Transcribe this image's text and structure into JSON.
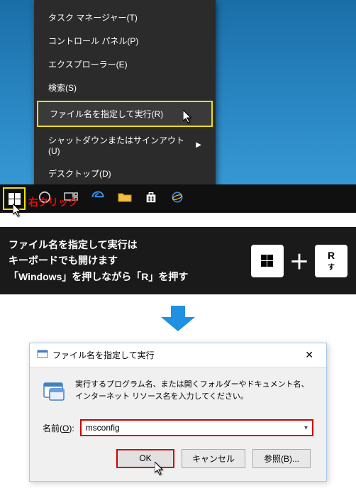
{
  "context_menu": {
    "items": [
      {
        "label": "タスク マネージャー(T)",
        "highlighted": false
      },
      {
        "label": "コントロール パネル(P)",
        "highlighted": false
      },
      {
        "label": "エクスプローラー(E)",
        "highlighted": false
      },
      {
        "label": "検索(S)",
        "highlighted": false
      },
      {
        "label": "ファイル名を指定して実行(R)",
        "highlighted": true
      },
      {
        "label": "シャットダウンまたはサインアウト(U)",
        "highlighted": false,
        "submenu": true
      },
      {
        "label": "デスクトップ(D)",
        "highlighted": false
      }
    ]
  },
  "right_click_label": "右クリック",
  "instruction": {
    "line1": "ファイル名を指定して実行は",
    "line2": "キーボードでも開けます",
    "line3": "「Windows」を押しながら「R」を押す"
  },
  "key_combo": {
    "plus": "＋",
    "r": "R",
    "r_sub": "す"
  },
  "run_dialog": {
    "title": "ファイル名を指定して実行",
    "close": "✕",
    "description": "実行するプログラム名、または開くフォルダーやドキュメント名、インターネット リソース名を入力してください。",
    "name_label_prefix": "名前(",
    "name_label_key": "O",
    "name_label_suffix": "):",
    "input_value": "msconfig",
    "ok": "OK",
    "cancel": "キャンセル",
    "browse": "参照(B)..."
  }
}
